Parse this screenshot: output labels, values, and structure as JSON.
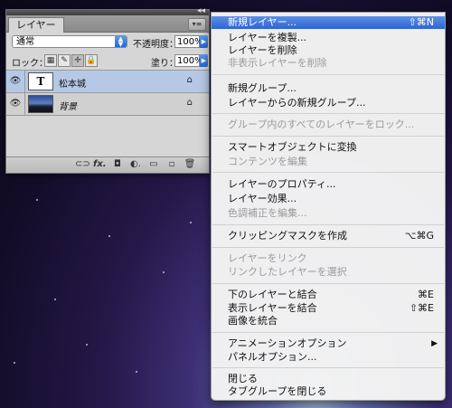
{
  "layers_panel": {
    "tab_label": "レイヤー",
    "collapse_glyph": "◂◂",
    "menu_glyph": "▾≡",
    "blend_mode": "通常",
    "opacity_label": "不透明度：",
    "opacity_value": "100%",
    "lock_label": "ロック：",
    "fill_label": "塗り：",
    "fill_value": "100%",
    "lock_glyphs": [
      "▦",
      "✎",
      "✛",
      "🔒"
    ],
    "layers": [
      {
        "name": "松本城",
        "thumb": "T",
        "type": "text",
        "selected": true
      },
      {
        "name": "背景",
        "thumb": "",
        "type": "image",
        "selected": false
      }
    ],
    "footer_icons": [
      "link-icon",
      "fx-icon",
      "mask-icon",
      "adjustment-icon",
      "group-icon",
      "new-layer-icon",
      "trash-icon"
    ],
    "footer_glyphs": [
      "⊂⊃",
      "fx.",
      "◘",
      "◐.",
      "▭",
      "▫",
      "🗑"
    ]
  },
  "context_menu": {
    "items": [
      {
        "label": "新規レイヤー...",
        "shortcut": "⇧⌘N",
        "enabled": true,
        "highlighted": true
      },
      {
        "label": "レイヤーを複製...",
        "enabled": true
      },
      {
        "label": "レイヤーを削除",
        "enabled": true
      },
      {
        "label": "非表示レイヤーを削除",
        "enabled": false
      },
      {
        "label": "新規グループ...",
        "enabled": true
      },
      {
        "label": "レイヤーからの新規グループ...",
        "enabled": true
      },
      {
        "label": "グループ内のすべてのレイヤーをロック...",
        "enabled": false
      },
      {
        "label": "スマートオブジェクトに変換",
        "enabled": true
      },
      {
        "label": "コンテンツを編集",
        "enabled": false
      },
      {
        "label": "レイヤーのプロパティ...",
        "enabled": true
      },
      {
        "label": "レイヤー効果...",
        "enabled": true
      },
      {
        "label": "色調補正を編集...",
        "enabled": false
      },
      {
        "label": "クリッピングマスクを作成",
        "shortcut": "⌥⌘G",
        "enabled": true
      },
      {
        "label": "レイヤーをリンク",
        "enabled": false
      },
      {
        "label": "リンクしたレイヤーを選択",
        "enabled": false
      },
      {
        "label": "下のレイヤーと結合",
        "shortcut": "⌘E",
        "enabled": true
      },
      {
        "label": "表示レイヤーを結合",
        "shortcut": "⇧⌘E",
        "enabled": true
      },
      {
        "label": "画像を統合",
        "enabled": true
      },
      {
        "label": "アニメーションオプション",
        "submenu": "▶",
        "enabled": true
      },
      {
        "label": "パネルオプション...",
        "enabled": true
      },
      {
        "label": "閉じる",
        "enabled": true
      },
      {
        "label": "タブグループを閉じる",
        "enabled": true
      }
    ]
  }
}
